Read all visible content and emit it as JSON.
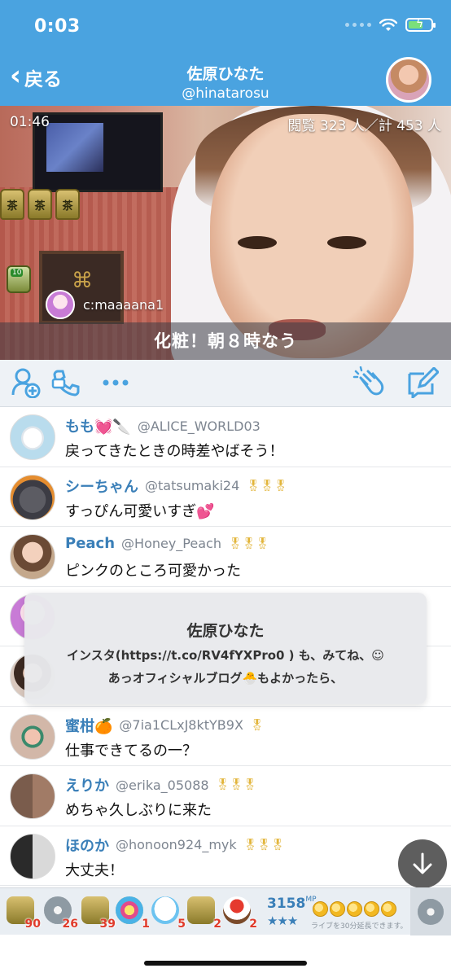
{
  "status": {
    "time": "0:03"
  },
  "nav": {
    "back_label": "戻る",
    "title": "佐原ひなた",
    "handle": "@hinatarosu"
  },
  "video": {
    "timer": "01:46",
    "viewers": "閲覧 323 人／計 453 人",
    "commenter": "c:maaaana1",
    "caption": "化粧！朝８時なう"
  },
  "actions": {
    "add_user": "add-user-icon",
    "call": "call-icon",
    "more": "more-icon",
    "clap": "clap-icon",
    "compose": "compose-icon"
  },
  "comments": [
    {
      "name": "もも💓🔪",
      "handle": "@ALICE_WORLD03",
      "medals": "",
      "text": "戻ってきたときの時差やばそう！",
      "avatar": "av-egg"
    },
    {
      "name": "シーちゃん",
      "handle": "@tatsumaki24",
      "medals": "🎖🎖🎖",
      "text": "すっぴん可愛いすぎ💕",
      "avatar": "av-cat"
    },
    {
      "name": "Peach",
      "handle": "@Honey_Peach",
      "medals": "🎖🎖🎖",
      "text": "ピンクのところ可愛かった",
      "avatar": "av-peach"
    },
    {
      "name": "",
      "handle": "",
      "medals": "",
      "text": "",
      "avatar": "av-pink"
    },
    {
      "name": "",
      "handle": "",
      "medals": "",
      "text": "",
      "avatar": "av-girl"
    },
    {
      "name": "蜜柑🍊",
      "handle": "@7ia1CLxJ8ktYB9X",
      "medals": "🎖",
      "text": "仕事できてるの一？",
      "avatar": "av-nails"
    },
    {
      "name": "えりか",
      "handle": "@erika_05088",
      "medals": "🎖🎖🎖",
      "text": "めちゃ久しぶりに来た",
      "avatar": "av-pair"
    },
    {
      "name": "ほのか",
      "handle": "@honoon924_myk",
      "medals": "🎖🎖🎖",
      "text": "大丈夫！",
      "avatar": "av-bw"
    }
  ],
  "popup": {
    "name": "佐原ひなた",
    "line1": "インスタ(https://t.co/RV4fYXPro0 ) も、みてね、☺",
    "line2": "あっオフィシャルブログ🐣もよかったら、"
  },
  "gifts": [
    {
      "count": "90",
      "icon": "g-tea"
    },
    {
      "count": "26",
      "icon": "g-disk"
    },
    {
      "count": "39",
      "icon": "g-tea"
    },
    {
      "count": "1",
      "icon": "g-flower"
    },
    {
      "count": "5",
      "icon": "g-ghost"
    },
    {
      "count": "2",
      "icon": "g-tea"
    },
    {
      "count": "2",
      "icon": "g-cake"
    }
  ],
  "points": {
    "value": "3158",
    "unit": "MP",
    "stars": "★★★",
    "extend": "ライブを30分延長できます。"
  },
  "colors": {
    "accent": "#4aa3e0",
    "name_blue": "#3a7fb8",
    "count_red": "#e03b2b"
  }
}
